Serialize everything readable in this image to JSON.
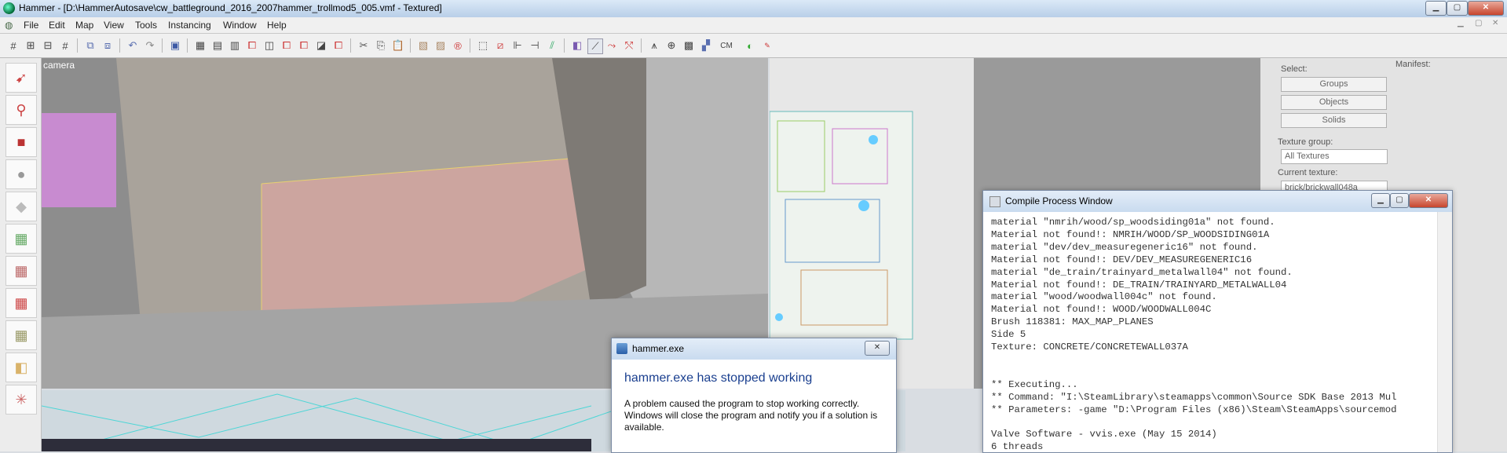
{
  "window": {
    "title": "Hammer - [D:\\HammerAutosave\\cw_battleground_2016_2007hammer_trollmod5_005.vmf - Textured]",
    "minimize": "▁",
    "maximize": "▢",
    "close": "✕"
  },
  "menu": [
    "File",
    "Edit",
    "Map",
    "View",
    "Tools",
    "Instancing",
    "Window",
    "Help"
  ],
  "toolbar": {
    "cm_label": "CM"
  },
  "viewport3d": {
    "label": "camera"
  },
  "right_panel": {
    "select_label": "Select:",
    "groups": "Groups",
    "objects": "Objects",
    "solids": "Solids",
    "texture_group_label": "Texture group:",
    "texture_group_value": "All Textures",
    "current_texture_label": "Current texture:",
    "current_texture_value": "brick/brickwall048a",
    "manifest_label": "Manifest:"
  },
  "compile_window": {
    "title": "Compile Process Window",
    "log": "material \"nmrih/wood/sp_woodsiding01a\" not found.\nMaterial not found!: NMRIH/WOOD/SP_WOODSIDING01A\nmaterial \"dev/dev_measuregeneric16\" not found.\nMaterial not found!: DEV/DEV_MEASUREGENERIC16\nmaterial \"de_train/trainyard_metalwall04\" not found.\nMaterial not found!: DE_TRAIN/TRAINYARD_METALWALL04\nmaterial \"wood/woodwall004c\" not found.\nMaterial not found!: WOOD/WOODWALL004C\nBrush 118381: MAX_MAP_PLANES\nSide 5\nTexture: CONCRETE/CONCRETEWALL037A\n\n\n** Executing...\n** Command: \"I:\\SteamLibrary\\steamapps\\common\\Source SDK Base 2013 Mul\n** Parameters: -game \"D:\\Program Files (x86)\\Steam\\SteamApps\\sourcemod\n\nValve Software - vvis.exe (May 15 2014)\n6 threads"
  },
  "error_dialog": {
    "title": "hammer.exe",
    "heading": "hammer.exe has stopped working",
    "body": "A problem caused the program to stop working correctly. Windows will close the program and notify you if a solution is available."
  }
}
